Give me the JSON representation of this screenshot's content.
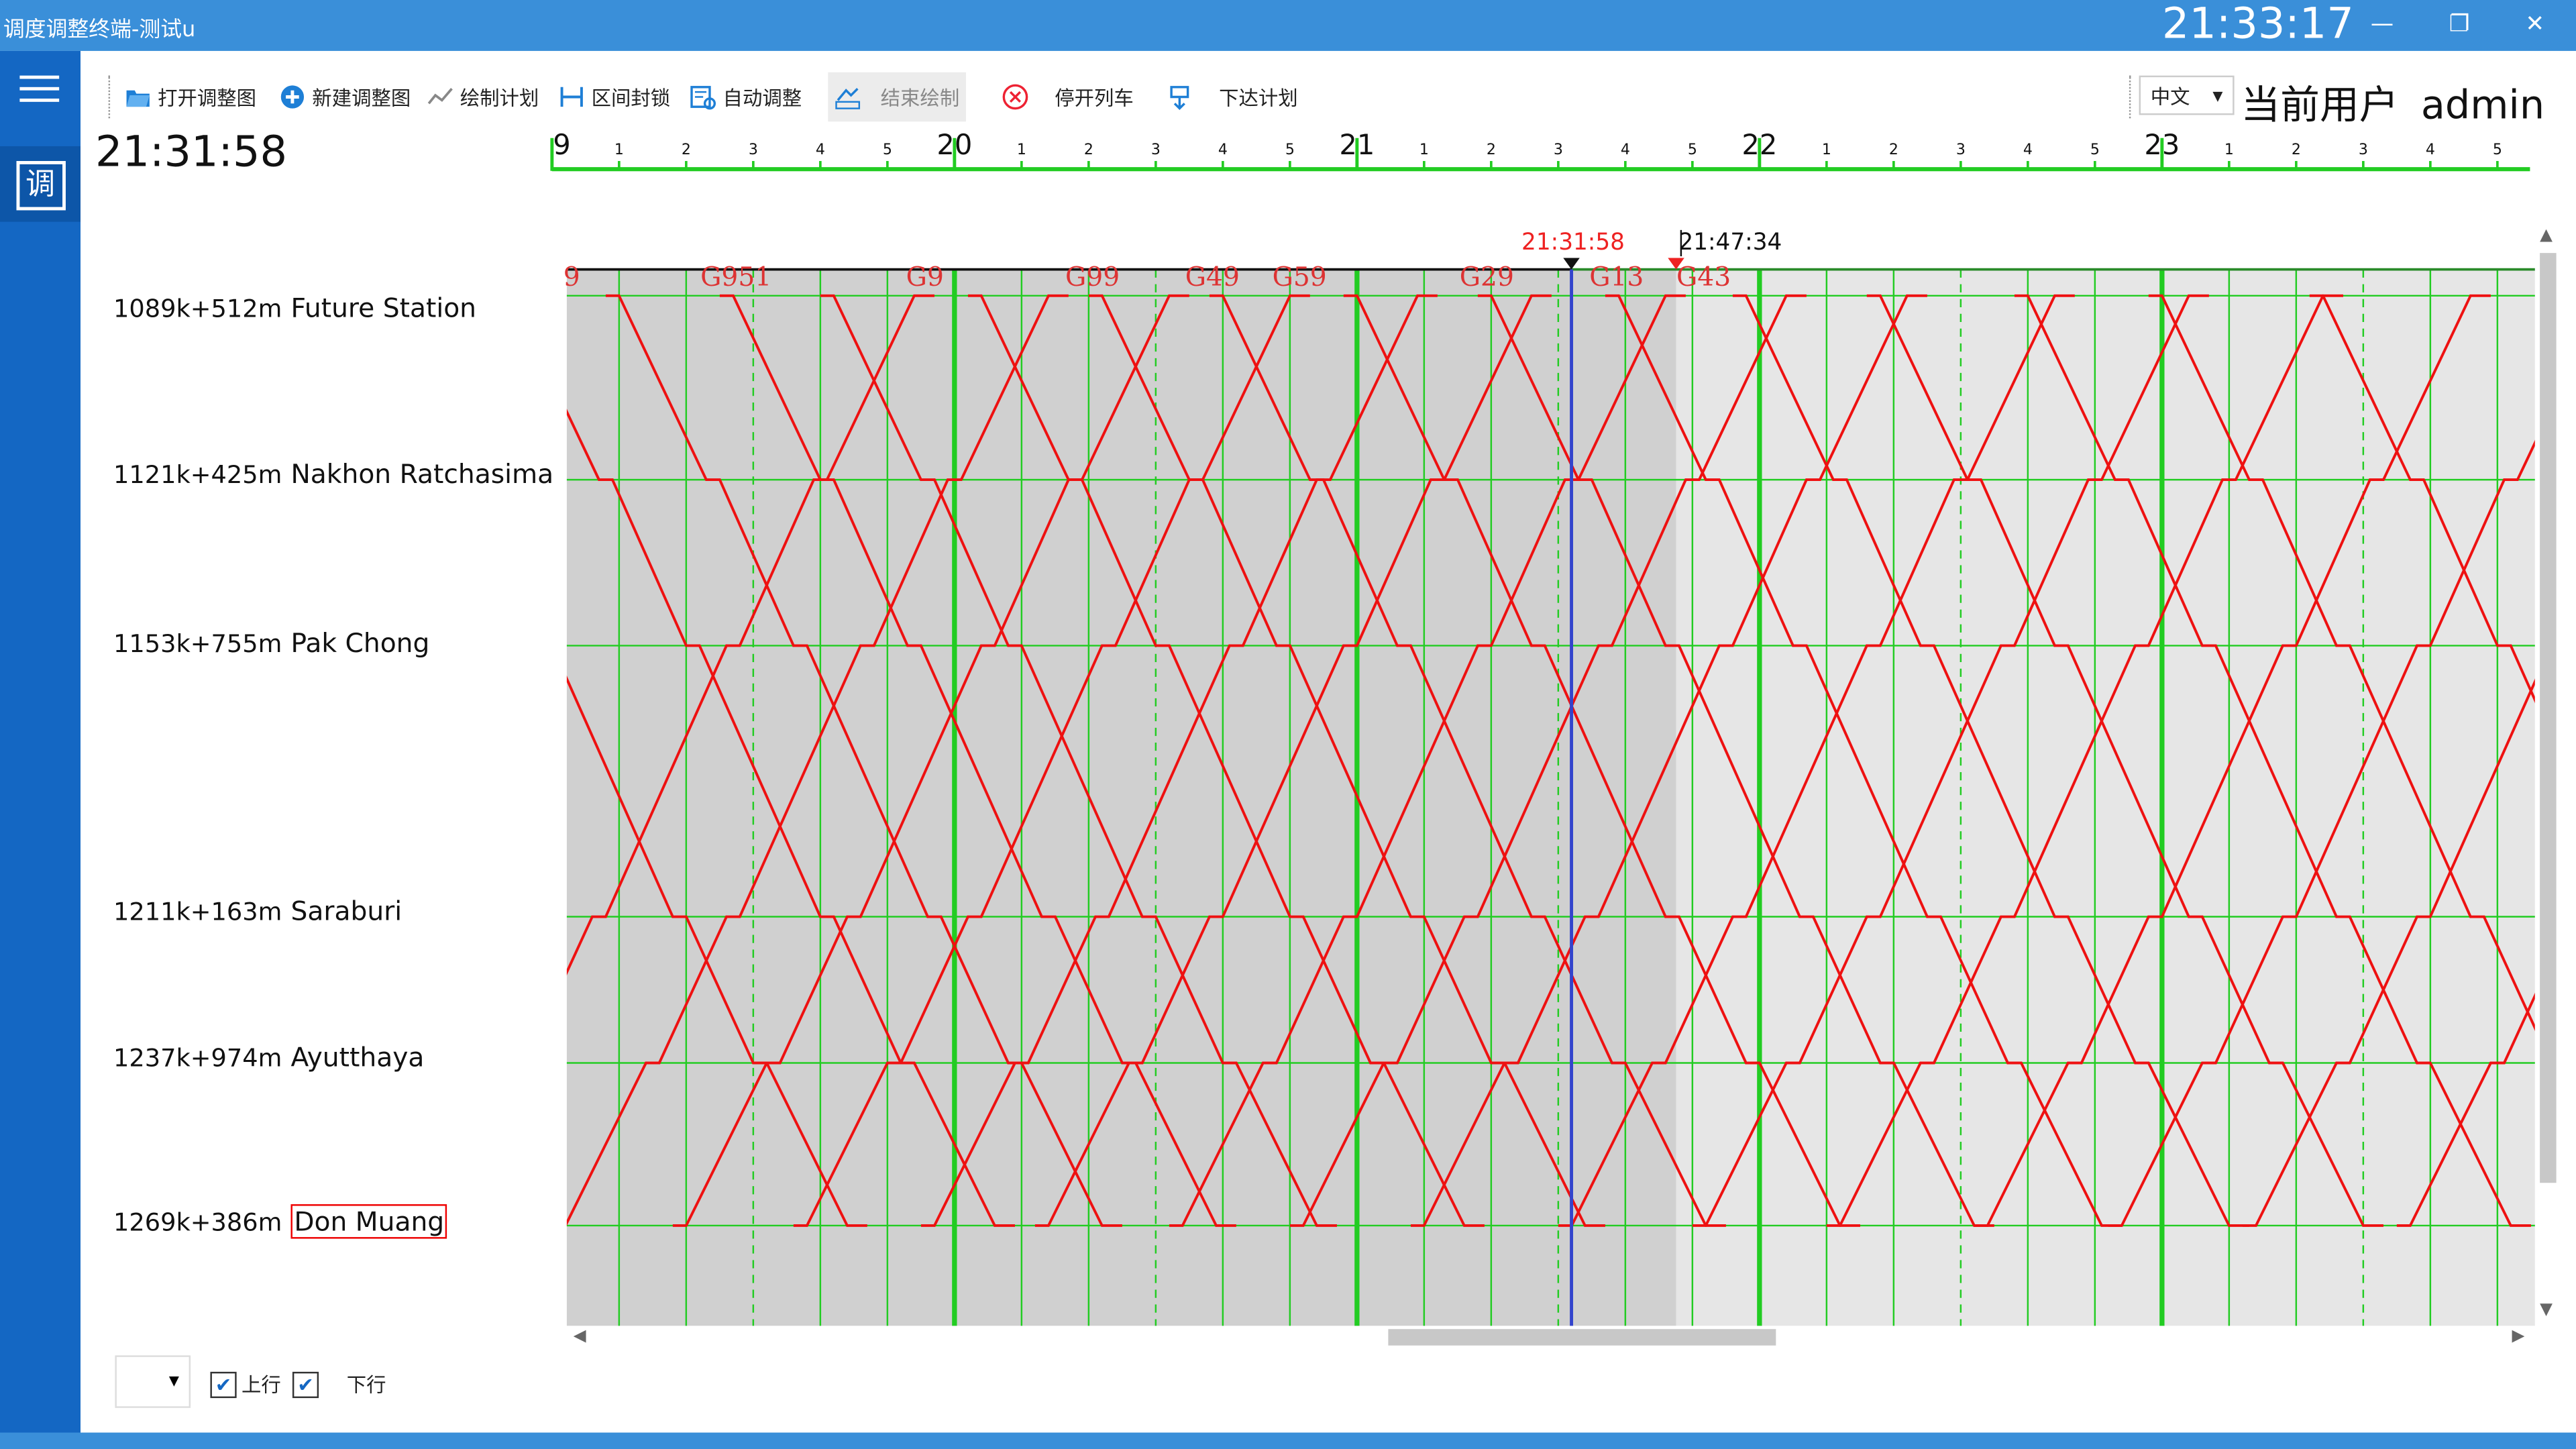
{
  "window": {
    "title": "调度调整终端-测试u",
    "clock": "21:33:17",
    "controls": [
      "—",
      "❐",
      "✕"
    ]
  },
  "sidebar": {
    "menu_icon": "hamburger-icon",
    "tile_label": "调"
  },
  "toolbar": {
    "items": [
      {
        "label": "打开调整图",
        "icon": "folder-open-icon",
        "enabled": true
      },
      {
        "label": "新建调整图",
        "icon": "plus-circle-icon",
        "enabled": true
      },
      {
        "label": "绘制计划",
        "icon": "line-chart-icon",
        "enabled": true
      },
      {
        "label": "区间封锁",
        "icon": "block-icon",
        "enabled": true
      },
      {
        "label": "自动调整",
        "icon": "auto-adjust-icon",
        "enabled": true
      },
      {
        "label": "结束绘制",
        "icon": "end-draw-icon",
        "enabled": false
      },
      {
        "label": "停开列车",
        "icon": "stop-circle-icon",
        "enabled": true
      },
      {
        "label": "下达计划",
        "icon": "dispatch-icon",
        "enabled": true
      }
    ],
    "language": "中文",
    "user_label": "当前用户",
    "user_name": "admin"
  },
  "current_time": "21:31:58",
  "time_axis": {
    "hours": [
      "9",
      "20",
      "21",
      "22",
      "23"
    ],
    "minor_labels": [
      "1",
      "2",
      "3",
      "4",
      "5"
    ],
    "now_marker": "21:31:58",
    "cursor_time": "21:47:34"
  },
  "stations": [
    {
      "km": "1089k+512m",
      "name": "Future Station"
    },
    {
      "km": "1121k+425m",
      "name": "Nakhon Ratchasima"
    },
    {
      "km": "1153k+755m",
      "name": "Pak Chong"
    },
    {
      "km": "1211k+163m",
      "name": "Saraburi"
    },
    {
      "km": "1237k+974m",
      "name": "Ayutthaya"
    },
    {
      "km": "1269k+386m",
      "name": "Don Muang",
      "selected": true
    }
  ],
  "trains": [
    "9",
    "G951",
    "G9",
    "G99",
    "G49",
    "G59",
    "G29",
    "G13",
    "G43"
  ],
  "bottom": {
    "up_label": "上行",
    "down_label": "下行",
    "up_checked": true,
    "down_checked": true
  },
  "colors": {
    "titlebar": "#3a8fd9",
    "sidebar": "#1467c3",
    "train_line": "#ee1111",
    "grid": "#22cc22",
    "past_bg": "#d0d0d0",
    "future_bg": "#e6e6e6"
  }
}
